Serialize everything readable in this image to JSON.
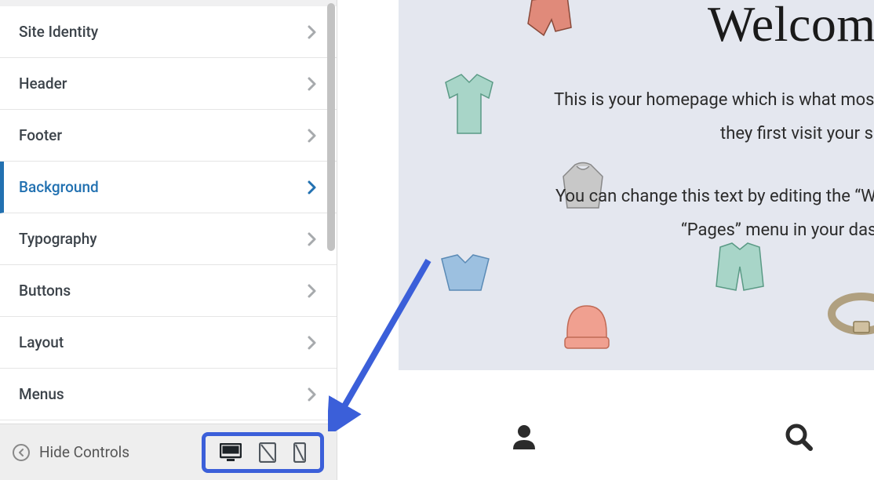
{
  "sidebar": {
    "items": [
      {
        "label": "Site Identity",
        "active": false
      },
      {
        "label": "Header",
        "active": false
      },
      {
        "label": "Footer",
        "active": false
      },
      {
        "label": "Background",
        "active": true
      },
      {
        "label": "Typography",
        "active": false
      },
      {
        "label": "Buttons",
        "active": false
      },
      {
        "label": "Layout",
        "active": false
      },
      {
        "label": "Menus",
        "active": false
      }
    ],
    "hide_controls_label": "Hide Controls"
  },
  "preview": {
    "hero_title": "Welcom",
    "hero_line1": "This is your homepage which is what mos",
    "hero_line2": "they first visit your sh",
    "hero_line3": "You can change this text by editing the “W",
    "hero_line4": "“Pages” menu in your dash"
  }
}
